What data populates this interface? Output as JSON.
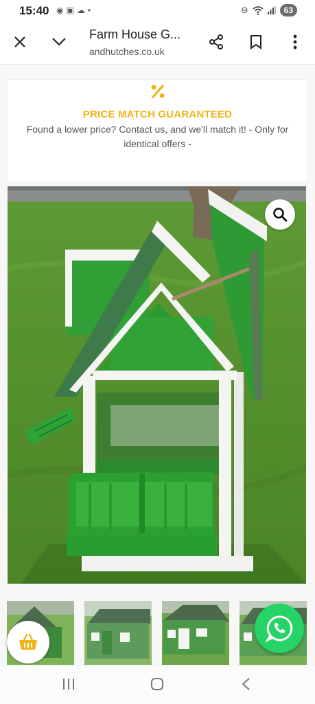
{
  "status_bar": {
    "time": "15:40",
    "left_icons": [
      "shield-icon",
      "screenshot-icon",
      "cloud-icon",
      "dot-icon"
    ],
    "right_icons": [
      "dnd-icon",
      "wifi-icon",
      "signal-icon"
    ],
    "battery": "63"
  },
  "toolbar": {
    "title": "Farm House G...",
    "url": "andhutches.co.uk",
    "icons": [
      "close-icon",
      "chevron-down-icon",
      "share-icon",
      "bookmark-icon",
      "more-vert-icon"
    ]
  },
  "promo": {
    "icon": "percent-icon",
    "title": "PRICE MATCH GUARANTEED",
    "text": "Found a lower price? Contact us, and we'll match it! - Only for identical offers -",
    "accent_color": "#f1b417"
  },
  "product_image": {
    "subject": "green chicken coop on grass",
    "zoom_icon": "search-icon"
  },
  "thumbnails": [
    "thumb-1",
    "thumb-2",
    "thumb-3",
    "thumb-4"
  ],
  "floating": {
    "basket_icon": "basket-icon",
    "whatsapp_icon": "whatsapp-icon",
    "whatsapp_color": "#25d366"
  },
  "nav_bar": {
    "icons": [
      "recents-icon",
      "home-icon",
      "back-icon"
    ]
  }
}
